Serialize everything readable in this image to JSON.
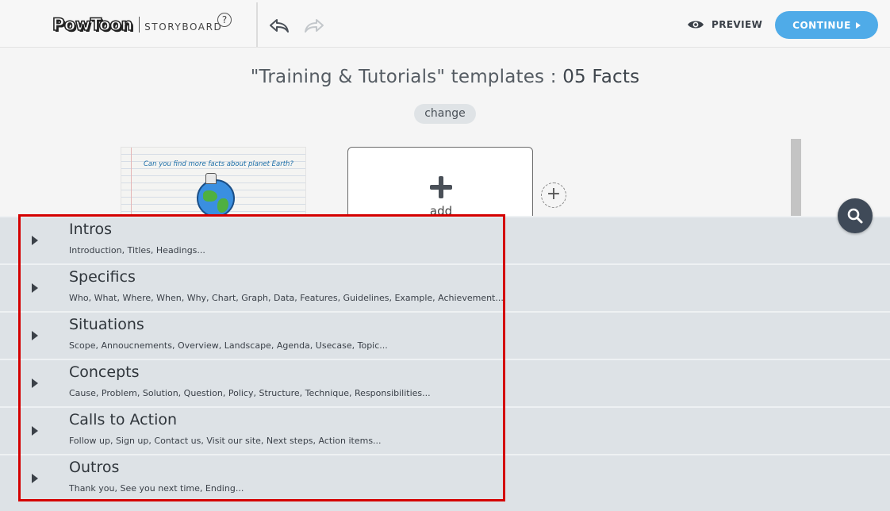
{
  "topbar": {
    "logo_text": "PowToon",
    "logo_subtitle": "STORYBOARD",
    "help_icon": "?",
    "preview_label": "PREVIEW",
    "continue_label": "CONTINUE",
    "icons": [
      "undo-icon",
      "redo-icon",
      "eye-icon",
      "caret-right-icon"
    ],
    "accent_color": "#4fabe8"
  },
  "header": {
    "title_prefix": "\"Training & Tutorials\" templates : ",
    "title_strong": "05 Facts",
    "change_label": "change"
  },
  "storyboard": {
    "thumbnail_caption": "Can you find more facts about planet Earth?",
    "add_label": "add",
    "insert_symbol": "+"
  },
  "categories": [
    {
      "title": "Intros",
      "desc": "Introduction, Titles, Headings..."
    },
    {
      "title": "Specifics",
      "desc": "Who, What, Where, When, Why, Chart, Graph, Data, Features, Guidelines, Example, Achievement..."
    },
    {
      "title": "Situations",
      "desc": "Scope, Annoucnements, Overview, Landscape, Agenda, Usecase, Topic..."
    },
    {
      "title": "Concepts",
      "desc": "Cause, Problem, Solution, Question, Policy, Structure, Technique, Responsibilities..."
    },
    {
      "title": "Calls to Action",
      "desc": "Follow up, Sign up, Contact us, Visit our site, Next steps, Action items..."
    },
    {
      "title": "Outros",
      "desc": "Thank you, See you next time, Ending..."
    }
  ],
  "colors": {
    "panel_bg": "#dde2e6",
    "highlight_border": "#d40000",
    "search_button": "#3f4a58"
  }
}
